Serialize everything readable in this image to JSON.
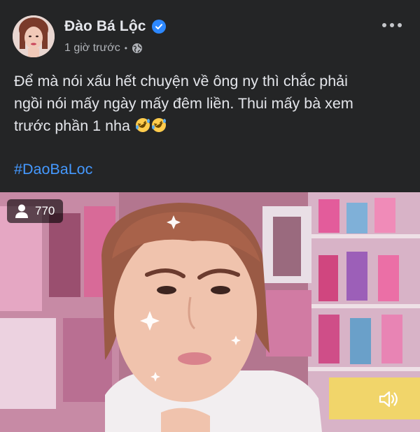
{
  "post": {
    "author_name": "Đào Bá Lộc",
    "timestamp": "1 giờ trước",
    "separator": "•",
    "privacy_icon": "globe-icon",
    "verified_icon": "verified-badge-icon",
    "more_icon": "more-options-icon",
    "text_line1": "Để mà nói xấu hết chuyện về ông ny thì chắc phải",
    "text_line2": "ngồi nói mấy ngày mấy đêm liền. Thui mấy bà xem",
    "text_line3": "trước phần 1 nha",
    "emoji": "rolling-on-floor-laughing-emoji",
    "hashtag": "#DaoBaLoc"
  },
  "video": {
    "viewer_count": "770",
    "viewer_icon": "person-icon",
    "mute_icon": "volume-icon"
  },
  "colors": {
    "background": "#242526",
    "text": "#e4e6eb",
    "secondary_text": "#b0b3b8",
    "hashtag": "#4599ff",
    "verified": "#2d88ff"
  }
}
